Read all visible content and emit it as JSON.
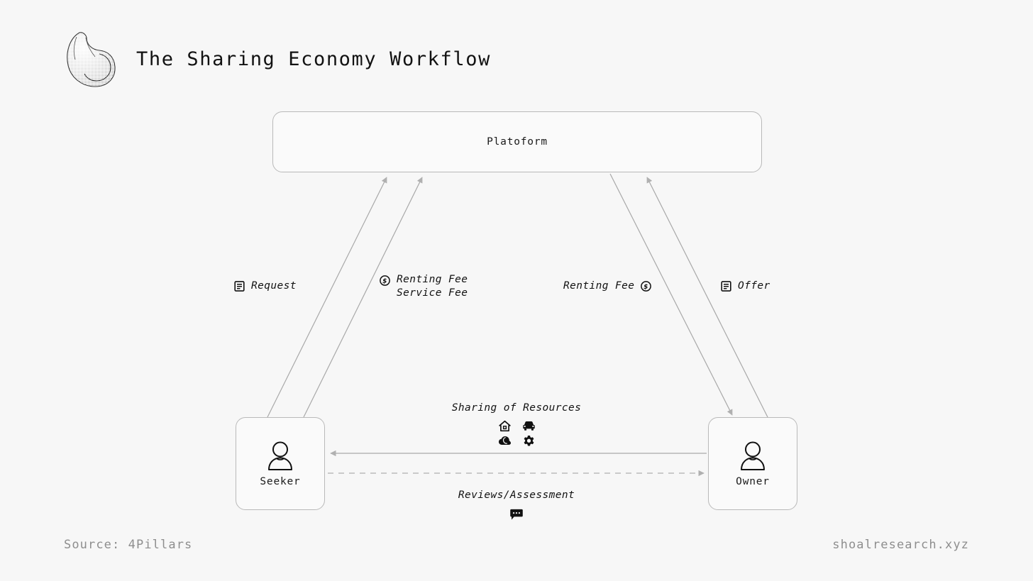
{
  "header": {
    "title": "The Sharing Economy Workflow",
    "logo_icon": "snail-shell-icon"
  },
  "nodes": {
    "platform": {
      "label": "Platoform"
    },
    "seeker": {
      "label": "Seeker",
      "icon": "person-icon"
    },
    "owner": {
      "label": "Owner",
      "icon": "person-icon"
    }
  },
  "edge_labels": {
    "request": {
      "text": "Request",
      "icon": "document-icon"
    },
    "fees_to_platform": {
      "line1": "Renting Fee",
      "line2": "Service Fee",
      "icon": "dollar-coin-icon"
    },
    "renting_fee_from_platform": {
      "text": "Renting Fee",
      "icon": "dollar-coin-icon"
    },
    "offer": {
      "text": "Offer",
      "icon": "document-icon"
    }
  },
  "center": {
    "sharing_title": "Sharing of Resources",
    "sharing_icons": [
      "home-icon",
      "car-icon",
      "cloud-icon",
      "gear-icon"
    ],
    "review_title": "Reviews/Assessment",
    "review_icon": "chat-bubble-icon"
  },
  "footer": {
    "source": "Source: 4Pillars",
    "site": "shoalresearch.xyz"
  },
  "colors": {
    "background": "#f7f7f7",
    "node_fill": "#fafafa",
    "node_stroke": "#b9b9b9",
    "edge_stroke": "#a8a8a8",
    "text": "#111111",
    "muted_text": "#8e8e8e"
  }
}
